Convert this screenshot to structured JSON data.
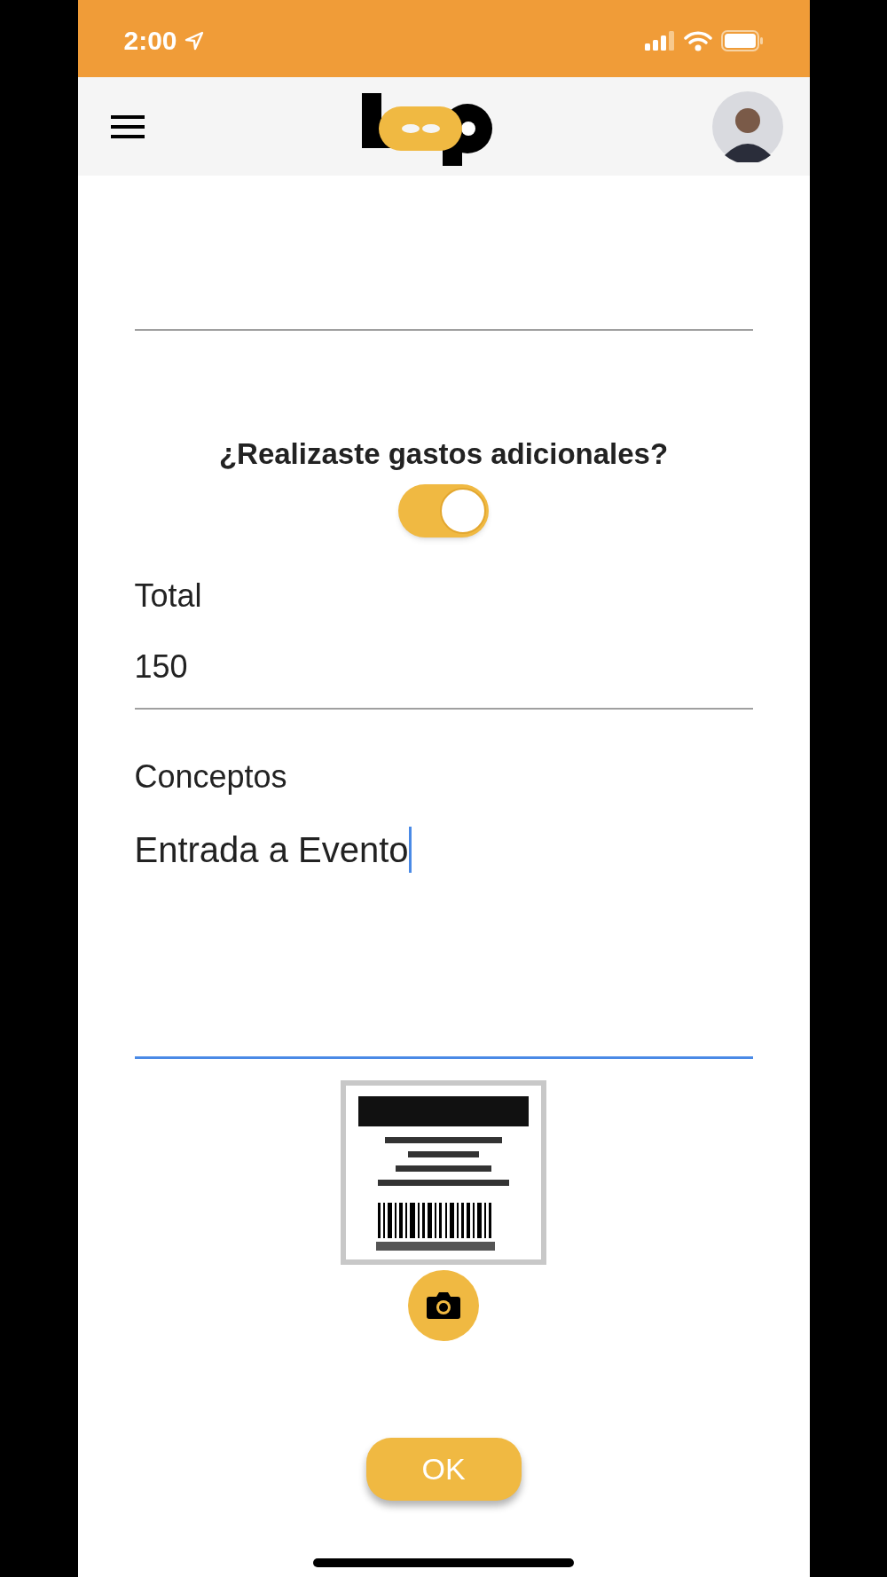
{
  "status_bar": {
    "time": "2:00"
  },
  "question": {
    "label": "¿Realizaste gastos adicionales?",
    "toggle": {
      "on": true
    }
  },
  "fields": [
    {
      "kind": "single",
      "label": "Total",
      "value": "150",
      "focused": false
    },
    {
      "kind": "multiline",
      "label": "Conceptos",
      "value": "Entrada a Evento",
      "focused": true
    }
  ],
  "ok_button": {
    "label": "OK"
  }
}
